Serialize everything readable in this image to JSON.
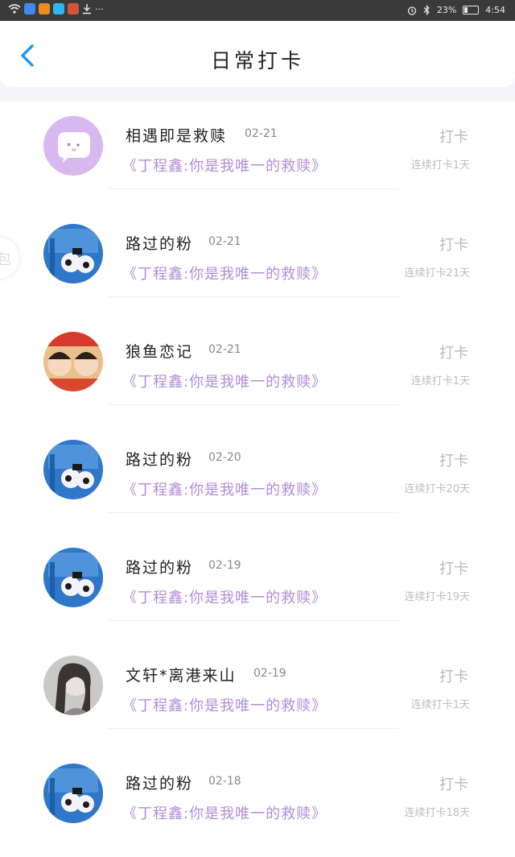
{
  "statusbar": {
    "battery_text": "23%",
    "time": "4:54",
    "battery_level": 0.23,
    "dots": "···"
  },
  "header": {
    "title": "日常打卡"
  },
  "float_button": {
    "label": "包"
  },
  "items": [
    {
      "name": "相遇即是救赎",
      "date": "02-21",
      "text": "《丁程鑫:你是我唯一的救赎》",
      "action": "打卡",
      "streak": "连续打卡1天"
    },
    {
      "name": "路过的粉",
      "date": "02-21",
      "text": "《丁程鑫:你是我唯一的救赎》",
      "action": "打卡",
      "streak": "连续打卡21天"
    },
    {
      "name": "狼鱼恋记",
      "date": "02-21",
      "text": "《丁程鑫:你是我唯一的救赎》",
      "action": "打卡",
      "streak": "连续打卡1天"
    },
    {
      "name": "路过的粉",
      "date": "02-20",
      "text": "《丁程鑫:你是我唯一的救赎》",
      "action": "打卡",
      "streak": "连续打卡20天"
    },
    {
      "name": "路过的粉",
      "date": "02-19",
      "text": "《丁程鑫:你是我唯一的救赎》",
      "action": "打卡",
      "streak": "连续打卡19天"
    },
    {
      "name": "文轩*离港来山",
      "date": "02-19",
      "text": "《丁程鑫:你是我唯一的救赎》",
      "action": "打卡",
      "streak": "连续打卡1天"
    },
    {
      "name": "路过的粉",
      "date": "02-18",
      "text": "《丁程鑫:你是我唯一的救赎》",
      "action": "打卡",
      "streak": "连续打卡18天"
    }
  ]
}
